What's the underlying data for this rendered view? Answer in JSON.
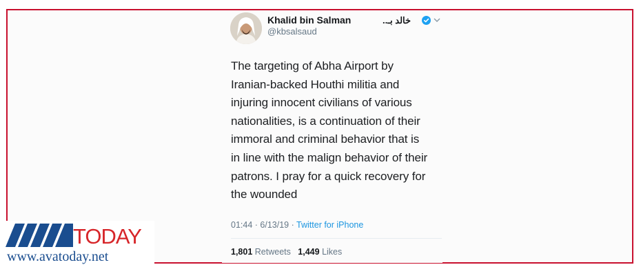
{
  "tweet": {
    "display_name": "Khalid bin Salman",
    "arabic_name": "خالد بـ..",
    "handle": "@kbsalsaud",
    "lines": [
      "The targeting of Abha Airport by",
      "Iranian-backed Houthi militia and",
      "injuring innocent civilians of various",
      "nationalities, is a continuation of their",
      "immoral and criminal behavior that is",
      "in line with the malign behavior of their",
      "patrons. I pray for a quick recovery for",
      "the wounded"
    ],
    "time": "01:44",
    "date": "6/13/19",
    "separator": "·",
    "source": "Twitter for iPhone",
    "retweets_count": "1,801",
    "retweets_label": "Retweets",
    "likes_count": "1,449",
    "likes_label": "Likes",
    "icons": [
      "verified-badge-icon",
      "chevron-down-icon"
    ]
  },
  "branding": {
    "logo_text": "AVATODAY",
    "website": "www.avatoday.net"
  },
  "colors": {
    "frame_border": "#c8102e",
    "twitter_blue": "#1b95e0",
    "logo_red": "#d7262a",
    "logo_blue": "#1a4d8f"
  }
}
